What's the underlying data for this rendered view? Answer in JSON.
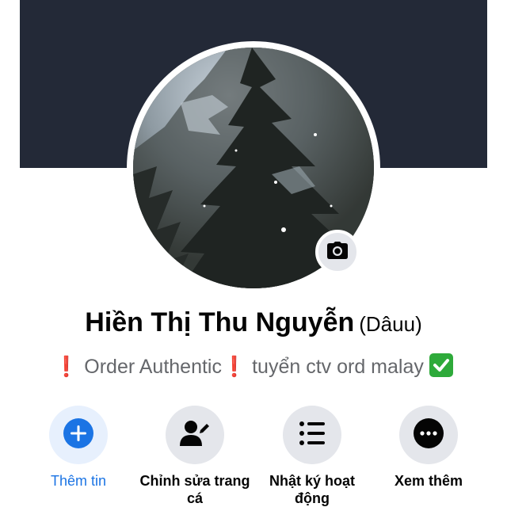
{
  "profile": {
    "name": "Hiền Thị Thu Nguyễn",
    "nickname": "(Dâuu)",
    "bio": {
      "part1": "Order Authentic",
      "part2": "tuyển ctv ord malay"
    }
  },
  "actions": [
    {
      "label": "Thêm tin",
      "icon": "plus-icon"
    },
    {
      "label": "Chỉnh sửa trang cá",
      "icon": "edit-profile-icon"
    },
    {
      "label": "Nhật ký hoạt động",
      "icon": "list-icon"
    },
    {
      "label": "Xem thêm",
      "icon": "more-icon"
    }
  ],
  "colors": {
    "cover": "#232937",
    "accent": "#1b74e4",
    "button_bg": "#e4e6eb"
  }
}
